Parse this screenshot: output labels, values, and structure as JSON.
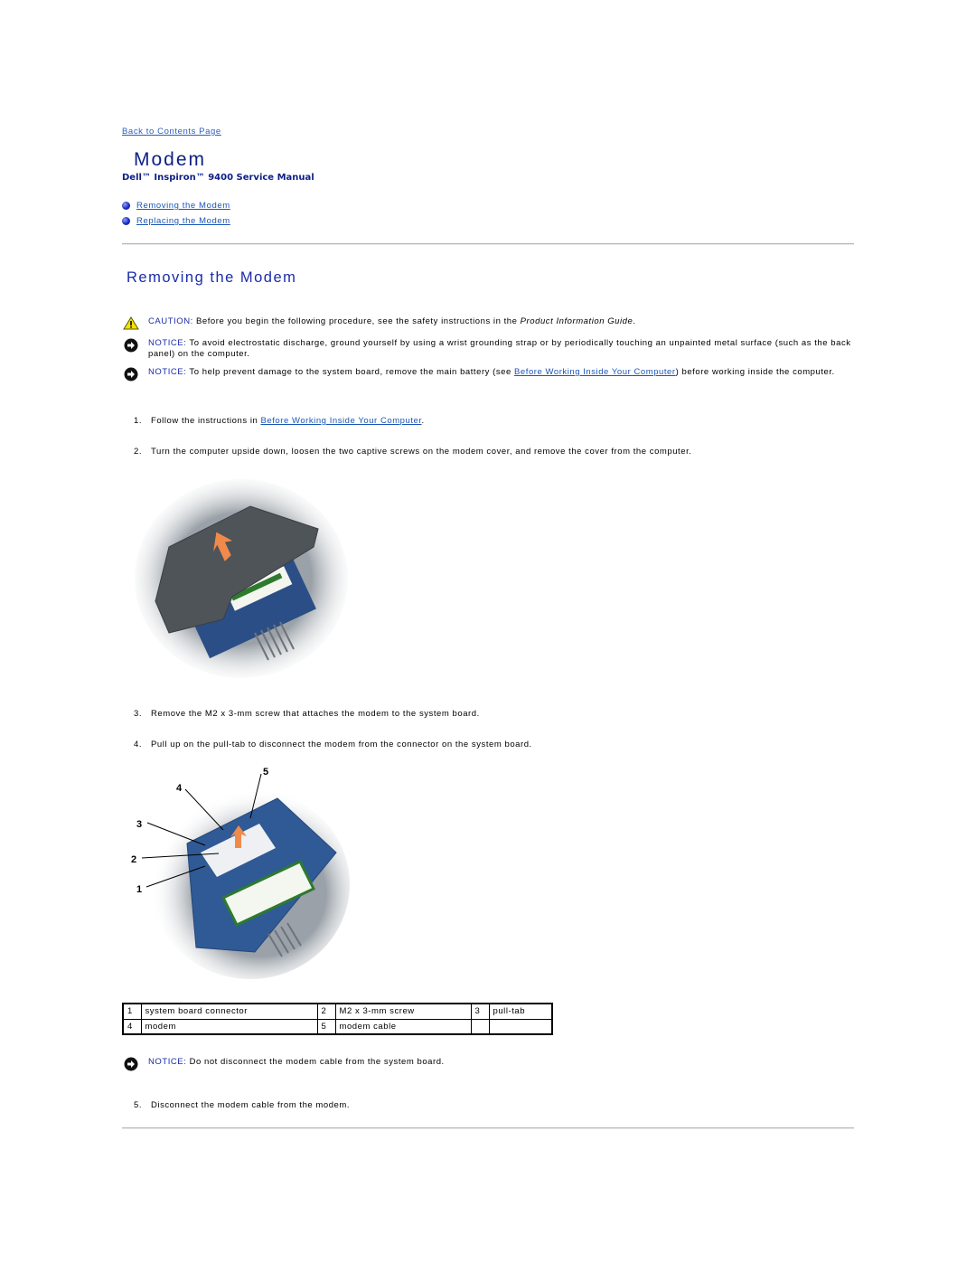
{
  "nav": {
    "back_link": "Back to Contents Page"
  },
  "header": {
    "title": "Modem",
    "subtitle": "Dell™ Inspiron™ 9400 Service Manual"
  },
  "toc": [
    {
      "label": "Removing the Modem"
    },
    {
      "label": "Replacing the Modem"
    }
  ],
  "section": {
    "title": "Removing the Modem",
    "caution": {
      "label": "CAUTION:",
      "text_before": " Before you begin the following procedure, see the safety instructions in the ",
      "emphasis": "Product Information Guide",
      "text_after": "."
    },
    "notice1": {
      "label": "NOTICE:",
      "text": " To avoid electrostatic discharge, ground yourself by using a wrist grounding strap or by periodically touching an unpainted metal surface (such as the back panel) on the computer."
    },
    "notice2": {
      "label": "NOTICE:",
      "text_before": " To help prevent damage to the system board, remove the main battery (see ",
      "link": "Before Working Inside Your Computer",
      "text_after": ") before working inside the computer."
    },
    "steps": [
      {
        "num": "1.",
        "text_before": "Follow the instructions in ",
        "link": "Before Working Inside Your Computer",
        "text_after": "."
      },
      {
        "num": "2.",
        "text": "Turn the computer upside down, loosen the two captive screws on the modem cover, and remove the cover from the computer."
      },
      {
        "num": "3.",
        "text": "Remove the M2 x 3-mm screw that attaches the modem to the system board."
      },
      {
        "num": "4.",
        "text": "Pull up on the pull-tab to disconnect the modem from the connector on the system board."
      },
      {
        "num": "5.",
        "text": "Disconnect the modem cable from the modem."
      }
    ],
    "figure2_callouts": [
      "1",
      "2",
      "3",
      "4",
      "5"
    ],
    "legend": [
      [
        {
          "n": "1",
          "t": "system board connector"
        },
        {
          "n": "2",
          "t": "M2 x 3-mm screw"
        },
        {
          "n": "3",
          "t": "pull-tab"
        }
      ],
      [
        {
          "n": "4",
          "t": "modem"
        },
        {
          "n": "5",
          "t": "modem cable"
        },
        {
          "n": "",
          "t": ""
        }
      ]
    ],
    "notice3": {
      "label": "NOTICE:",
      "text": " Do not disconnect the modem cable from the system board."
    }
  }
}
